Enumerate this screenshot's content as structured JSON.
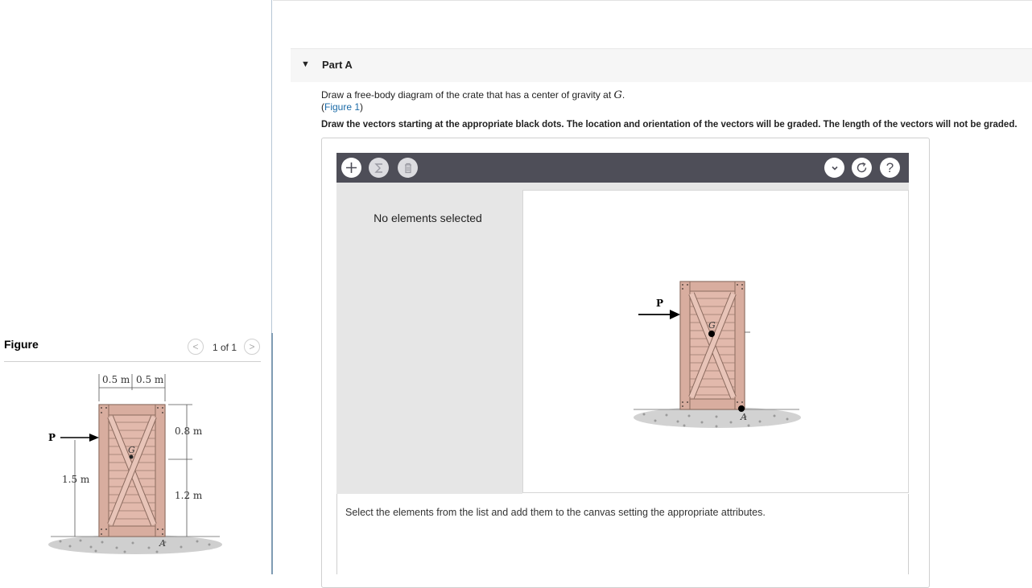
{
  "figure_panel": {
    "label": "Figure",
    "counter": "1 of 1",
    "prev_icon": "<",
    "next_icon": ">",
    "drawing": {
      "width_left": "0.5 m",
      "width_right": "0.5 m",
      "height_upper": "0.8 m",
      "height_lower": "1.2 m",
      "force_height": "1.5 m",
      "force_label": "P",
      "cg_label": "G",
      "point_label": "A"
    }
  },
  "part": {
    "caret": "▼",
    "title": "Part A",
    "instruction_prefix": "Draw a free-body diagram of the crate that has a center of gravity at ",
    "instruction_symbol": "G",
    "instruction_suffix": ".",
    "figure_link_open": "(",
    "figure_link_text": "Figure 1",
    "figure_link_close": ")",
    "bold_instruction": "Draw the vectors starting at the appropriate black dots. The location and orientation of the vectors will be graded. The length of the vectors will not be graded."
  },
  "tool": {
    "toolbar": {
      "add_icon": "plus-icon",
      "sigma_icon": "sigma-icon",
      "delete_icon": "trash-icon",
      "dropdown_icon": "chevron-down-icon",
      "reset_icon": "reset-icon",
      "help_label": "?"
    },
    "no_selection": "No elements selected",
    "canvas": {
      "force_label": "P",
      "cg_label": "G",
      "point_label": "A"
    },
    "hint": "Select the elements from the list and add them to the canvas setting the appropriate attributes."
  },
  "colors": {
    "toolbar_bg": "#4e4e58",
    "panel_bg": "#e6e6e6",
    "link": "#1a6aa7",
    "crate_wood": "#e2b9ac",
    "crate_stroke": "#8a6a5e"
  }
}
